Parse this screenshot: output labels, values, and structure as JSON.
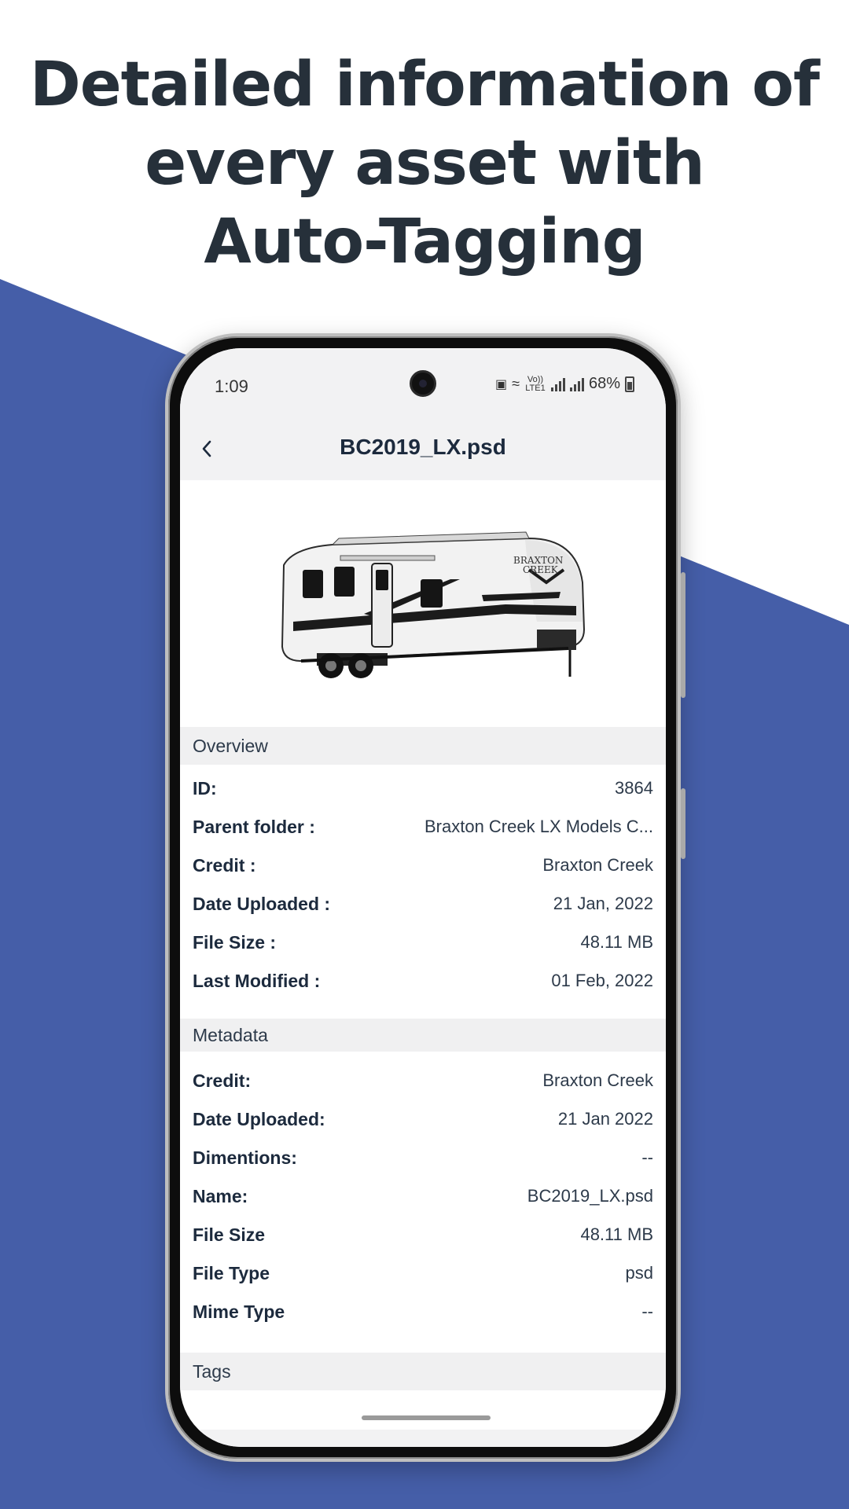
{
  "headline": {
    "line1": "Detailed information of",
    "line2": "every asset with",
    "line3": "Auto-Tagging"
  },
  "colors": {
    "background_blue": "#455ea8",
    "headline_text": "#26303a",
    "app_text": "#1c2a3d"
  },
  "status_bar": {
    "time": "1:09",
    "network_label": "Vo)) LTE1",
    "battery": "68%"
  },
  "app_bar": {
    "back_icon": "chevron-left-icon",
    "title": "BC2019_LX.psd"
  },
  "overview": {
    "header": "Overview",
    "rows": [
      {
        "label": "ID:",
        "value": "3864"
      },
      {
        "label": "Parent folder :",
        "value": "Braxton Creek LX Models C..."
      },
      {
        "label": "Credit :",
        "value": "Braxton Creek"
      },
      {
        "label": "Date Uploaded :",
        "value": "21 Jan, 2022"
      },
      {
        "label": "File Size :",
        "value": "48.11 MB"
      },
      {
        "label": "Last Modified :",
        "value": "01 Feb, 2022"
      }
    ]
  },
  "metadata": {
    "header": "Metadata",
    "rows": [
      {
        "label": "Credit:",
        "value": "Braxton Creek"
      },
      {
        "label": "Date Uploaded:",
        "value": "21 Jan 2022"
      },
      {
        "label": "Dimentions:",
        "value": "--"
      },
      {
        "label": "Name:",
        "value": "BC2019_LX.psd"
      },
      {
        "label": "File Size",
        "value": "48.11 MB"
      },
      {
        "label": "File Type",
        "value": "psd"
      },
      {
        "label": "Mime Type",
        "value": "--"
      }
    ]
  },
  "tags": {
    "header": "Tags"
  }
}
